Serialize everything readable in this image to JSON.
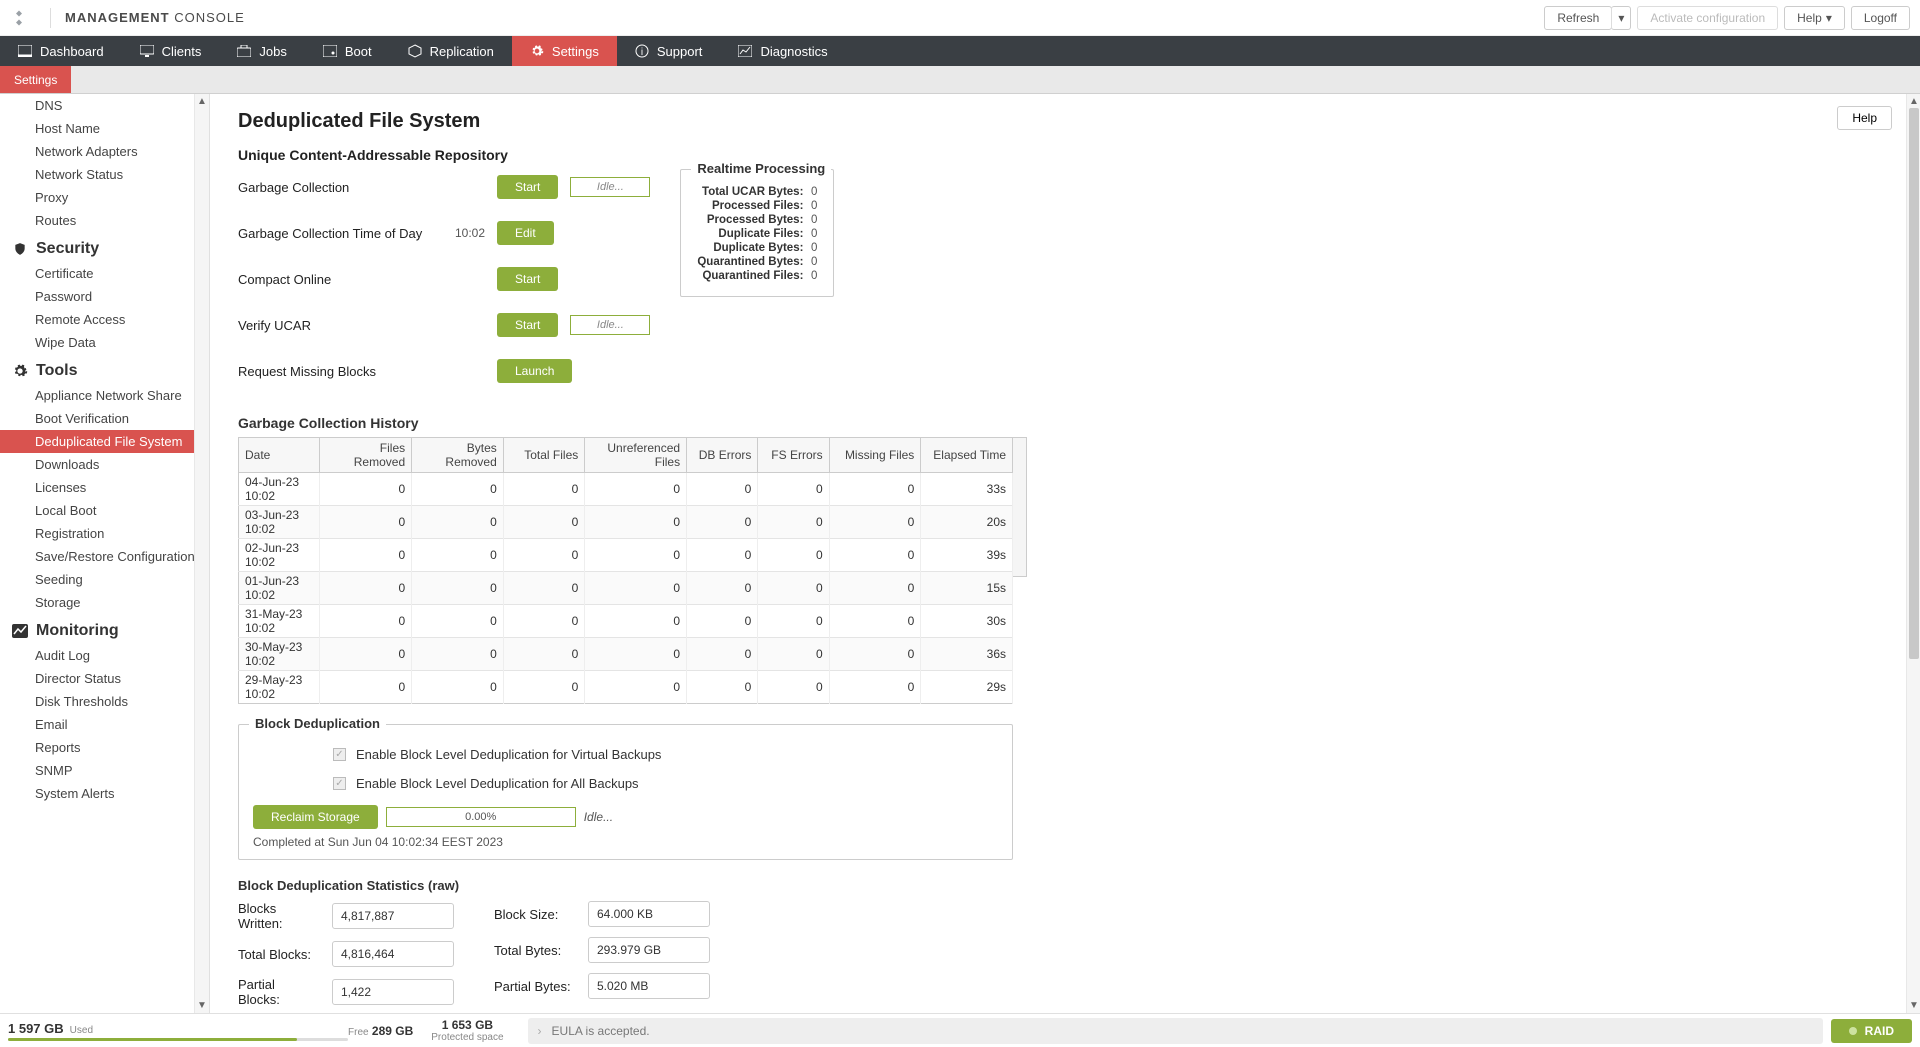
{
  "header": {
    "app_title_strong": "MANAGEMENT",
    "app_title_light": "CONSOLE",
    "refresh": "Refresh",
    "activate": "Activate configuration",
    "help": "Help",
    "logoff": "Logoff"
  },
  "nav": {
    "dashboard": "Dashboard",
    "clients": "Clients",
    "jobs": "Jobs",
    "boot": "Boot",
    "replication": "Replication",
    "settings": "Settings",
    "support": "Support",
    "diagnostics": "Diagnostics"
  },
  "subnav": {
    "settings": "Settings"
  },
  "sidebar": {
    "network_items": [
      "DNS",
      "Host Name",
      "Network Adapters",
      "Network Status",
      "Proxy",
      "Routes"
    ],
    "security_title": "Security",
    "security_items": [
      "Certificate",
      "Password",
      "Remote Access",
      "Wipe Data"
    ],
    "tools_title": "Tools",
    "tools_items": [
      "Appliance Network Share",
      "Boot Verification",
      "Deduplicated File System",
      "Downloads",
      "Licenses",
      "Local Boot",
      "Registration",
      "Save/Restore Configuration",
      "Seeding",
      "Storage"
    ],
    "tools_active_index": 2,
    "monitoring_title": "Monitoring",
    "monitoring_items": [
      "Audit Log",
      "Director Status",
      "Disk Thresholds",
      "Email",
      "Reports",
      "SNMP",
      "System Alerts"
    ]
  },
  "page": {
    "title": "Deduplicated File System",
    "help": "Help",
    "ucar_title": "Unique Content-Addressable Repository",
    "actions": {
      "gc": "Garbage Collection",
      "gc_tod": "Garbage Collection Time of Day",
      "gc_time": "10:02",
      "compact": "Compact Online",
      "verify": "Verify UCAR",
      "request": "Request Missing Blocks",
      "start": "Start",
      "edit": "Edit",
      "launch": "Launch",
      "idle": "Idle..."
    },
    "realtime": {
      "title": "Realtime Processing",
      "total_ucar_bytes": {
        "k": "Total UCAR Bytes:",
        "v": "0"
      },
      "processed_files": {
        "k": "Processed Files:",
        "v": "0"
      },
      "processed_bytes": {
        "k": "Processed Bytes:",
        "v": "0"
      },
      "duplicate_files": {
        "k": "Duplicate Files:",
        "v": "0"
      },
      "duplicate_bytes": {
        "k": "Duplicate Bytes:",
        "v": "0"
      },
      "quarantined_bytes": {
        "k": "Quarantined Bytes:",
        "v": "0"
      },
      "quarantined_files": {
        "k": "Quarantined Files:",
        "v": "0"
      }
    },
    "gch": {
      "title": "Garbage Collection History",
      "cols": [
        "Date",
        "Files Removed",
        "Bytes Removed",
        "Total Files",
        "Unreferenced Files",
        "DB Errors",
        "FS Errors",
        "Missing Files",
        "Elapsed Time"
      ],
      "rows": [
        [
          "04-Jun-23 10:02",
          "0",
          "0",
          "0",
          "0",
          "0",
          "0",
          "0",
          "33s"
        ],
        [
          "03-Jun-23 10:02",
          "0",
          "0",
          "0",
          "0",
          "0",
          "0",
          "0",
          "20s"
        ],
        [
          "02-Jun-23 10:02",
          "0",
          "0",
          "0",
          "0",
          "0",
          "0",
          "0",
          "39s"
        ],
        [
          "01-Jun-23 10:02",
          "0",
          "0",
          "0",
          "0",
          "0",
          "0",
          "0",
          "15s"
        ],
        [
          "31-May-23 10:02",
          "0",
          "0",
          "0",
          "0",
          "0",
          "0",
          "0",
          "30s"
        ],
        [
          "30-May-23 10:02",
          "0",
          "0",
          "0",
          "0",
          "0",
          "0",
          "0",
          "36s"
        ],
        [
          "29-May-23 10:02",
          "0",
          "0",
          "0",
          "0",
          "0",
          "0",
          "0",
          "29s"
        ]
      ]
    },
    "dedup": {
      "title": "Block Deduplication",
      "chk1": "Enable Block Level Deduplication for Virtual Backups",
      "chk2": "Enable Block Level Deduplication for All Backups",
      "reclaim": "Reclaim Storage",
      "progress": "0.00%",
      "idle": "Idle...",
      "completed": "Completed at Sun Jun 04 10:02:34 EEST 2023"
    },
    "stats": {
      "title": "Block Deduplication Statistics (raw)",
      "blocks_written_l": "Blocks Written:",
      "blocks_written": "4,817,887",
      "total_blocks_l": "Total Blocks:",
      "total_blocks": "4,816,464",
      "partial_blocks_l": "Partial Blocks:",
      "partial_blocks": "1,422",
      "block_size_l": "Block Size:",
      "block_size": "64.000 KB",
      "total_bytes_l": "Total Bytes:",
      "total_bytes": "293.979 GB",
      "partial_bytes_l": "Partial Bytes:",
      "partial_bytes": "5.020 MB"
    }
  },
  "footer": {
    "used_val": "1 597 GB",
    "used_label": "Used",
    "free_label": "Free",
    "free_val": "289 GB",
    "protected_val": "1 653 GB",
    "protected_label": "Protected space",
    "eula": "EULA is accepted.",
    "raid": "RAID"
  }
}
